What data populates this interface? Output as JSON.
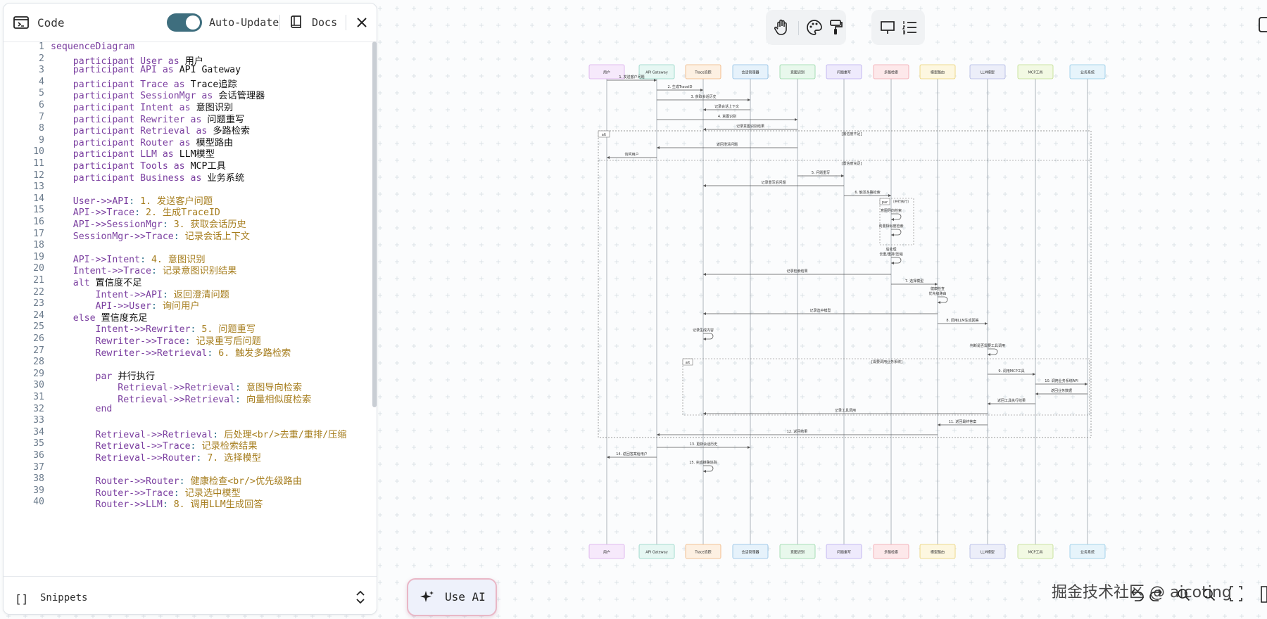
{
  "panel": {
    "title": "Code",
    "auto_update_label": "Auto-Update",
    "auto_update_on": true,
    "docs_label": "Docs",
    "snippets_label": "Snippets",
    "snippets_icon_text": "[]"
  },
  "code_lines": [
    {
      "n": "1",
      "t": "sequenceDiagram"
    },
    {
      "n": "2",
      "t": "    participant User as 用户"
    },
    {
      "n": "3",
      "t": "    participant API as API Gateway"
    },
    {
      "n": "4",
      "t": "    participant Trace as Trace追踪"
    },
    {
      "n": "5",
      "t": "    participant SessionMgr as 会话管理器"
    },
    {
      "n": "6",
      "t": "    participant Intent as 意图识别"
    },
    {
      "n": "7",
      "t": "    participant Rewriter as 问题重写"
    },
    {
      "n": "8",
      "t": "    participant Retrieval as 多路检索"
    },
    {
      "n": "9",
      "t": "    participant Router as 模型路由"
    },
    {
      "n": "10",
      "t": "    participant LLM as LLM模型"
    },
    {
      "n": "11",
      "t": "    participant Tools as MCP工具"
    },
    {
      "n": "12",
      "t": "    participant Business as 业务系统"
    },
    {
      "n": "13",
      "t": ""
    },
    {
      "n": "14",
      "t": "    User->>API: 1. 发送客户问题"
    },
    {
      "n": "15",
      "t": "    API->>Trace: 2. 生成TraceID"
    },
    {
      "n": "16",
      "t": "    API->>SessionMgr: 3. 获取会话历史"
    },
    {
      "n": "17",
      "t": "    SessionMgr->>Trace: 记录会话上下文"
    },
    {
      "n": "18",
      "t": ""
    },
    {
      "n": "19",
      "t": "    API->>Intent: 4. 意图识别"
    },
    {
      "n": "20",
      "t": "    Intent->>Trace: 记录意图识别结果"
    },
    {
      "n": "21",
      "t": "    alt 置信度不足"
    },
    {
      "n": "22",
      "t": "        Intent->>API: 返回澄清问题"
    },
    {
      "n": "23",
      "t": "        API->>User: 询问用户"
    },
    {
      "n": "24",
      "t": "    else 置信度充足"
    },
    {
      "n": "25",
      "t": "        Intent->>Rewriter: 5. 问题重写"
    },
    {
      "n": "26",
      "t": "        Rewriter->>Trace: 记录重写后问题"
    },
    {
      "n": "27",
      "t": "        Rewriter->>Retrieval: 6. 触发多路检索"
    },
    {
      "n": "28",
      "t": ""
    },
    {
      "n": "29",
      "t": "        par 并行执行"
    },
    {
      "n": "30",
      "t": "            Retrieval->>Retrieval: 意图导向检索"
    },
    {
      "n": "31",
      "t": "            Retrieval->>Retrieval: 向量相似度检索"
    },
    {
      "n": "32",
      "t": "        end"
    },
    {
      "n": "33",
      "t": ""
    },
    {
      "n": "34",
      "t": "        Retrieval->>Retrieval: 后处理<br/>去重/重排/压缩"
    },
    {
      "n": "35",
      "t": "        Retrieval->>Trace: 记录检索结果"
    },
    {
      "n": "36",
      "t": "        Retrieval->>Router: 7. 选择模型"
    },
    {
      "n": "37",
      "t": ""
    },
    {
      "n": "38",
      "t": "        Router->>Router: 健康检查<br/>优先级路由"
    },
    {
      "n": "39",
      "t": "        Router->>Trace: 记录选中模型"
    },
    {
      "n": "40",
      "t": "        Router->>LLM: 8. 调用LLM生成回答"
    }
  ],
  "toolbar": {
    "hand_icon": "hand-icon",
    "palette_icon": "palette-icon",
    "paint_icon": "paint-roller-icon",
    "present_icon": "presentation-icon",
    "list_icon": "list-icon"
  },
  "diagram": {
    "participants": [
      "用户",
      "API Gateway",
      "Trace追踪",
      "会话管理器",
      "意图识别",
      "问题重写",
      "多路检索",
      "模型路由",
      "LLM模型",
      "MCP工具",
      "业务系统"
    ],
    "participant_colors": [
      "#f6e9fb",
      "#e6f7f3",
      "#fdf0e2",
      "#e6f2fb",
      "#e8f8ec",
      "#eeeafc",
      "#fde8ea",
      "#fdf7e0",
      "#eceef9",
      "#f2f9e3",
      "#e6f4fb"
    ],
    "participant_borders": [
      "#d9a9ec",
      "#8fd3c3",
      "#efb27a",
      "#8bbde3",
      "#93d6a4",
      "#b6a8ee",
      "#f1a2ab",
      "#e9cf6f",
      "#aeb5e3",
      "#bfdc8a",
      "#8fc9e6"
    ],
    "messages": [
      {
        "label": "1. 发送客户问题"
      },
      {
        "label": "2. 生成TraceID"
      },
      {
        "label": "3. 获取会话历史"
      },
      {
        "label": "记录会话上下文"
      },
      {
        "label": "4. 意图识别"
      },
      {
        "label": "记录意图识别结果"
      },
      {
        "label": "返回澄清问题"
      },
      {
        "label": "询问用户"
      },
      {
        "label": "5. 问题重写"
      },
      {
        "label": "记录重写后问题"
      },
      {
        "label": "6. 触发多路检索"
      },
      {
        "label": "意图导向检索"
      },
      {
        "label": "向量相似度检索"
      },
      {
        "label": "后处理"
      },
      {
        "label": "去重/重排/压缩"
      },
      {
        "label": "记录检索结果"
      },
      {
        "label": "7. 选择模型"
      },
      {
        "label": "健康检查"
      },
      {
        "label": "优先级路由"
      },
      {
        "label": "记录选中模型"
      },
      {
        "label": "8. 调用LLM生成回答"
      },
      {
        "label": "记录生成内容"
      },
      {
        "label": "判断是否需要工具调用"
      },
      {
        "label": "9. 调用MCP工具"
      },
      {
        "label": "10. 调用业务系统API"
      },
      {
        "label": "返回业务数据"
      },
      {
        "label": "返回工具执行结果"
      },
      {
        "label": "记录工具调用"
      },
      {
        "label": "11. 返回最终答案"
      },
      {
        "label": "12. 返回结果"
      },
      {
        "label": "13. 更新会话历史"
      },
      {
        "label": "14. 返回答案给用户"
      },
      {
        "label": "15. 完成链路追踪"
      }
    ],
    "fragments": {
      "alt_label": "alt",
      "alt_cond": "[置信度不足]",
      "else_cond": "[置信度充足]",
      "par_label": "par",
      "par_cond": "[并行执行]",
      "alt2_label": "alt",
      "alt2_cond": "[需要调用业务系统]"
    }
  },
  "use_ai": {
    "label": "Use AI"
  },
  "watermark": "掘金技术社区 @ aicoting",
  "bottom_icons": [
    "undo-icon",
    "redo-icon",
    "zoom-in-icon",
    "zoom-out-icon",
    "fit-screen-icon"
  ]
}
